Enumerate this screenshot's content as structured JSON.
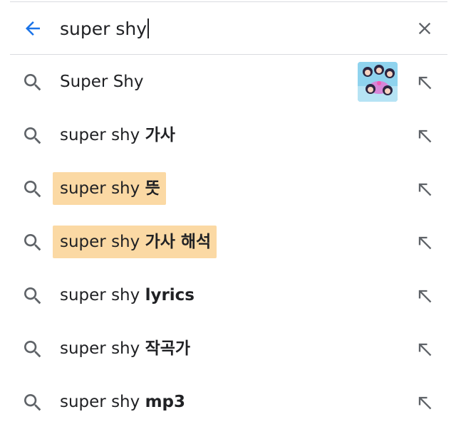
{
  "search": {
    "query": "super shy"
  },
  "suggestions": [
    {
      "text": "Super Shy",
      "bold": "",
      "highlighted": false,
      "thumbnail": true
    },
    {
      "text": "super shy ",
      "bold": "가사",
      "highlighted": false,
      "thumbnail": false
    },
    {
      "text": "super shy ",
      "bold": "뜻",
      "highlighted": true,
      "thumbnail": false
    },
    {
      "text": "super shy ",
      "bold": "가사 해석",
      "highlighted": true,
      "thumbnail": false
    },
    {
      "text": "super shy ",
      "bold": "lyrics",
      "highlighted": false,
      "thumbnail": false
    },
    {
      "text": "super shy ",
      "bold": "작곡가",
      "highlighted": false,
      "thumbnail": false
    },
    {
      "text": "super shy ",
      "bold": "mp3",
      "highlighted": false,
      "thumbnail": false
    }
  ],
  "colors": {
    "accent": "#1a73e8",
    "icon_gray": "#5f6368",
    "highlight": "#fbd59a"
  },
  "icons": {
    "back": "arrow-back-icon",
    "clear": "close-icon",
    "suggestion": "search-icon",
    "fill": "north-west-arrow-icon"
  }
}
